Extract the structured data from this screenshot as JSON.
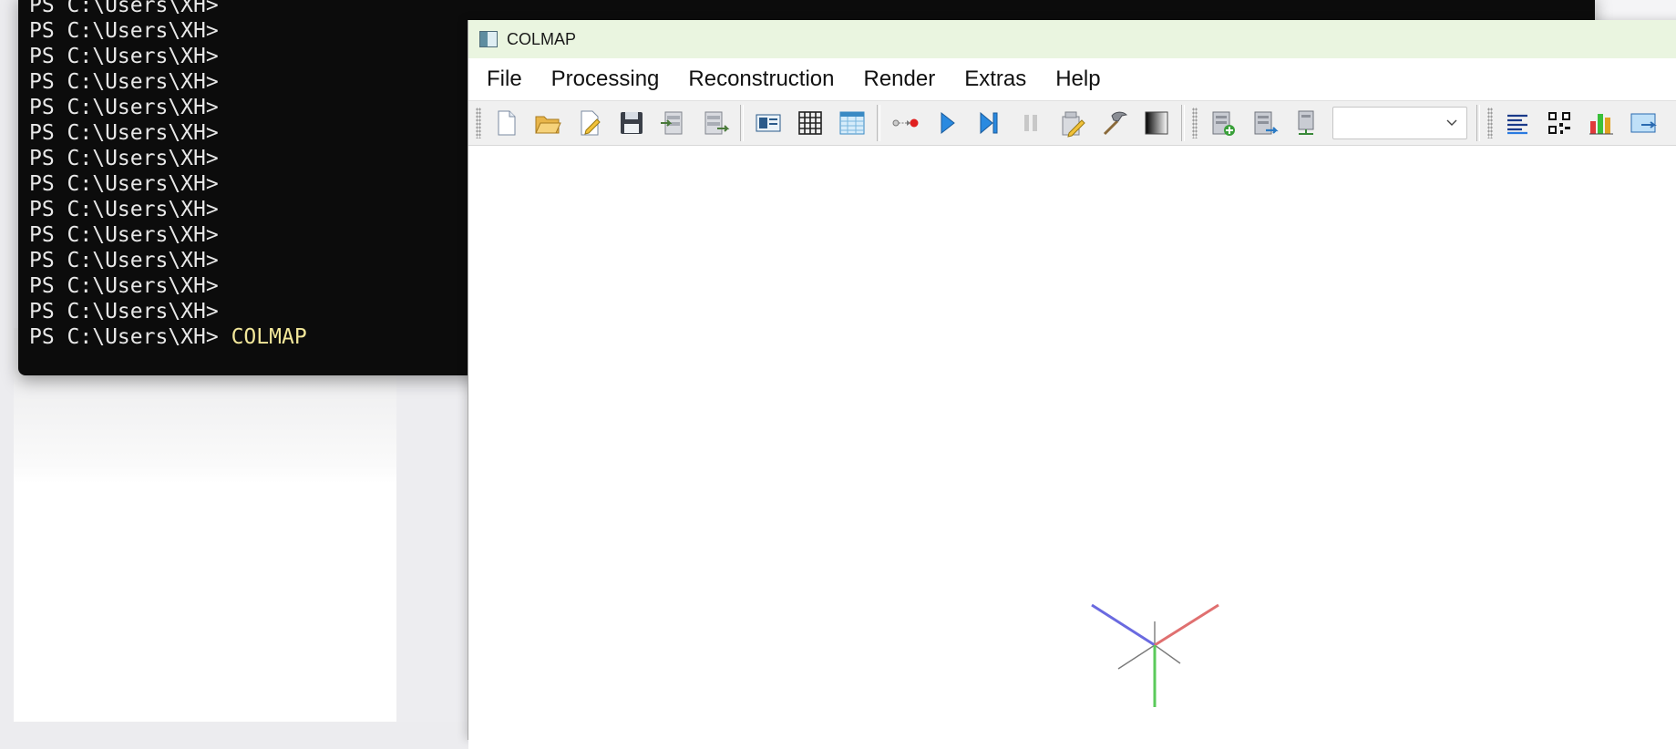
{
  "terminal": {
    "prompt": "PS C:\\Users\\XH>",
    "lines": [
      "PS C:\\Users\\XH>",
      "PS C:\\Users\\XH>",
      "PS C:\\Users\\XH>",
      "PS C:\\Users\\XH>",
      "PS C:\\Users\\XH>",
      "PS C:\\Users\\XH>",
      "PS C:\\Users\\XH>",
      "PS C:\\Users\\XH>",
      "PS C:\\Users\\XH>",
      "PS C:\\Users\\XH>",
      "PS C:\\Users\\XH>",
      "PS C:\\Users\\XH>",
      "PS C:\\Users\\XH>"
    ],
    "last_command": "COLMAP"
  },
  "window": {
    "title": "COLMAP"
  },
  "menu": [
    "File",
    "Processing",
    "Reconstruction",
    "Render",
    "Extras",
    "Help"
  ],
  "toolbar": {
    "groups": [
      [
        "new-project-icon",
        "open-project-icon",
        "edit-project-icon",
        "save-project-icon",
        "import-model-icon",
        "export-model-icon"
      ],
      [
        "feature-extraction-icon",
        "feature-matching-icon",
        "database-management-icon"
      ],
      [
        "automatic-reconstruction-icon",
        "start-reconstruction-icon",
        "step-reconstruction-icon",
        "pause-reconstruction-icon",
        "reconstruction-options-icon",
        "bundle-adjustment-icon",
        "dense-reconstruction-icon"
      ],
      [
        "add-model-icon",
        "reset-model-icon",
        "render-options-icon"
      ],
      [
        "reconstruction-stats-icon",
        "match-matrix-icon",
        "model-stats-icon",
        "screenshot-icon"
      ]
    ],
    "model_selector_value": ""
  },
  "colors": {
    "axis_x": "#e07070",
    "axis_y": "#5aca5a",
    "axis_z": "#6a6ae0",
    "grid": "#7a7a7a"
  }
}
